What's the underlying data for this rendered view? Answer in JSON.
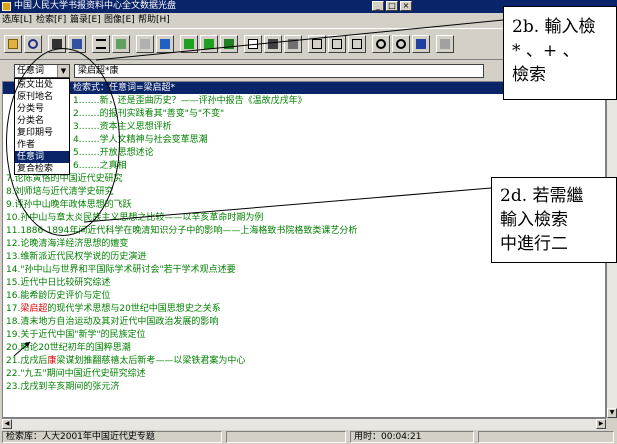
{
  "window": {
    "title": "中国人民大学书报资料中心全文数据光盘",
    "title_buttons": [
      "_",
      "□",
      "×"
    ]
  },
  "menu": {
    "items": [
      "选库[L]",
      "检索[F]",
      "篇录[E]",
      "图像[E]",
      "帮助[H]"
    ]
  },
  "toolbar": {
    "buttons": [
      "open-icon",
      "search-icon",
      "binoculars-icon",
      "print-icon",
      "list-icon",
      "image-icon",
      "text-icon",
      "filter-icon",
      "down-arrow-icon",
      "up-arrow-icon",
      "back-icon",
      "document-icon",
      "save-icon",
      "printer-icon",
      "copy-icon",
      "paste-icon",
      "page-icon",
      "zoom-in-icon",
      "zoom-out-icon",
      "refresh-icon",
      "tools-icon"
    ]
  },
  "search": {
    "field_selected": "任意词",
    "query": "梁启超*康"
  },
  "field_dropdown": {
    "options": [
      "原文出处",
      "原刊地名",
      "分类号",
      "分类名",
      "复印期号",
      "作者",
      "任意词",
      "复合检索"
    ],
    "selected_index": 6
  },
  "results": {
    "header": "检索式：任意词=梁启超*",
    "rows": [
      {
        "pre": "1.",
        "hl": "",
        "post": "……新，还是歪曲历史？——评孙中报告《温故戊戌年》"
      },
      {
        "pre": "2.",
        "hl": "",
        "post": "……的报刊实践看其\"善变\"与\"不变\""
      },
      {
        "pre": "3.",
        "hl": "",
        "post": "……资本主义思想评析"
      },
      {
        "pre": "4.",
        "hl": "",
        "post": "……学人文精神与社会变革思潮"
      },
      {
        "pre": "5.",
        "hl": "",
        "post": "……开放思想述论"
      },
      {
        "pre": "6.",
        "hl": "",
        "post": "……之真相"
      },
      {
        "pre": "7.论陈寅恪的中国近代史研究",
        "hl": "",
        "post": ""
      },
      {
        "pre": "8.刘师培与近代清学史研究",
        "hl": "",
        "post": ""
      },
      {
        "pre": "9.评孙中山晚年政体思想的飞跃",
        "hl": "",
        "post": ""
      },
      {
        "pre": "10.孙中山与章太炎民族主义思想之比较——以辛亥革命时期为例",
        "hl": "",
        "post": ""
      },
      {
        "pre": "11.1886-1894年间近代科学在晚清知识分子中的影响——上海格致书院格致类课艺分析",
        "hl": "",
        "post": ""
      },
      {
        "pre": "12.论晚清海洋经济思想的嬗变",
        "hl": "",
        "post": ""
      },
      {
        "pre": "13.维新派近代民权学说的历史演进",
        "hl": "",
        "post": ""
      },
      {
        "pre": "14.\"孙中山与世界和平国际学术研讨会\"若干学术观点述要",
        "hl": "",
        "post": ""
      },
      {
        "pre": "15.近代中日比较研究综述",
        "hl": "",
        "post": ""
      },
      {
        "pre": "16.能希龄历史评价与定位",
        "hl": "",
        "post": ""
      },
      {
        "pre": "17.",
        "hl": "梁启超",
        "post": "的现代学术思想与20世纪中国思想史之关系"
      },
      {
        "pre": "18.清末地方自治运动及其对近代中国政治发展的影响",
        "hl": "",
        "post": ""
      },
      {
        "pre": "19.关于近代中国\"新学\"的民族定位",
        "hl": "",
        "post": ""
      },
      {
        "pre": "20.略论20世纪初年的国粹思潮",
        "hl": "",
        "post": ""
      },
      {
        "pre": "21.戊戌后",
        "hl": "康",
        "post": "梁谋划推翻慈禧太后新考——以梁铁君案为中心"
      },
      {
        "pre": "22.\"九五\"期间中国近代史研究综述",
        "hl": "",
        "post": ""
      },
      {
        "pre": "23.戊戌到辛亥期间的张元济",
        "hl": "",
        "post": ""
      }
    ]
  },
  "status": {
    "database": "检索库：人大2001年中国近代史专题",
    "time": "用时：00:04:21"
  },
  "callouts": [
    {
      "lines": [
        "2b. 輸入檢",
        "* 、+ 、",
        "檢索"
      ]
    },
    {
      "lines": [
        "2d. 若需繼",
        "輸入檢索",
        "中進行二"
      ]
    }
  ]
}
